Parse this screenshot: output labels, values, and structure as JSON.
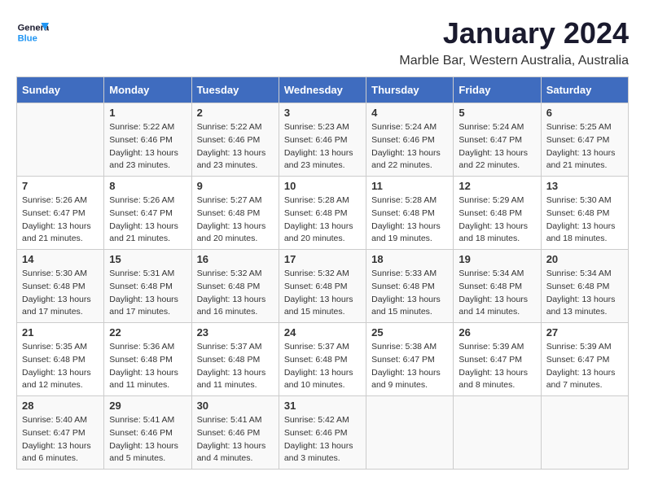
{
  "logo": {
    "line1": "General",
    "line2": "Blue"
  },
  "title": "January 2024",
  "subtitle": "Marble Bar, Western Australia, Australia",
  "days_header": [
    "Sunday",
    "Monday",
    "Tuesday",
    "Wednesday",
    "Thursday",
    "Friday",
    "Saturday"
  ],
  "weeks": [
    [
      {
        "num": "",
        "sunrise": "",
        "sunset": "",
        "daylight": ""
      },
      {
        "num": "1",
        "sunrise": "Sunrise: 5:22 AM",
        "sunset": "Sunset: 6:46 PM",
        "daylight": "Daylight: 13 hours and 23 minutes."
      },
      {
        "num": "2",
        "sunrise": "Sunrise: 5:22 AM",
        "sunset": "Sunset: 6:46 PM",
        "daylight": "Daylight: 13 hours and 23 minutes."
      },
      {
        "num": "3",
        "sunrise": "Sunrise: 5:23 AM",
        "sunset": "Sunset: 6:46 PM",
        "daylight": "Daylight: 13 hours and 23 minutes."
      },
      {
        "num": "4",
        "sunrise": "Sunrise: 5:24 AM",
        "sunset": "Sunset: 6:46 PM",
        "daylight": "Daylight: 13 hours and 22 minutes."
      },
      {
        "num": "5",
        "sunrise": "Sunrise: 5:24 AM",
        "sunset": "Sunset: 6:47 PM",
        "daylight": "Daylight: 13 hours and 22 minutes."
      },
      {
        "num": "6",
        "sunrise": "Sunrise: 5:25 AM",
        "sunset": "Sunset: 6:47 PM",
        "daylight": "Daylight: 13 hours and 21 minutes."
      }
    ],
    [
      {
        "num": "7",
        "sunrise": "Sunrise: 5:26 AM",
        "sunset": "Sunset: 6:47 PM",
        "daylight": "Daylight: 13 hours and 21 minutes."
      },
      {
        "num": "8",
        "sunrise": "Sunrise: 5:26 AM",
        "sunset": "Sunset: 6:47 PM",
        "daylight": "Daylight: 13 hours and 21 minutes."
      },
      {
        "num": "9",
        "sunrise": "Sunrise: 5:27 AM",
        "sunset": "Sunset: 6:48 PM",
        "daylight": "Daylight: 13 hours and 20 minutes."
      },
      {
        "num": "10",
        "sunrise": "Sunrise: 5:28 AM",
        "sunset": "Sunset: 6:48 PM",
        "daylight": "Daylight: 13 hours and 20 minutes."
      },
      {
        "num": "11",
        "sunrise": "Sunrise: 5:28 AM",
        "sunset": "Sunset: 6:48 PM",
        "daylight": "Daylight: 13 hours and 19 minutes."
      },
      {
        "num": "12",
        "sunrise": "Sunrise: 5:29 AM",
        "sunset": "Sunset: 6:48 PM",
        "daylight": "Daylight: 13 hours and 18 minutes."
      },
      {
        "num": "13",
        "sunrise": "Sunrise: 5:30 AM",
        "sunset": "Sunset: 6:48 PM",
        "daylight": "Daylight: 13 hours and 18 minutes."
      }
    ],
    [
      {
        "num": "14",
        "sunrise": "Sunrise: 5:30 AM",
        "sunset": "Sunset: 6:48 PM",
        "daylight": "Daylight: 13 hours and 17 minutes."
      },
      {
        "num": "15",
        "sunrise": "Sunrise: 5:31 AM",
        "sunset": "Sunset: 6:48 PM",
        "daylight": "Daylight: 13 hours and 17 minutes."
      },
      {
        "num": "16",
        "sunrise": "Sunrise: 5:32 AM",
        "sunset": "Sunset: 6:48 PM",
        "daylight": "Daylight: 13 hours and 16 minutes."
      },
      {
        "num": "17",
        "sunrise": "Sunrise: 5:32 AM",
        "sunset": "Sunset: 6:48 PM",
        "daylight": "Daylight: 13 hours and 15 minutes."
      },
      {
        "num": "18",
        "sunrise": "Sunrise: 5:33 AM",
        "sunset": "Sunset: 6:48 PM",
        "daylight": "Daylight: 13 hours and 15 minutes."
      },
      {
        "num": "19",
        "sunrise": "Sunrise: 5:34 AM",
        "sunset": "Sunset: 6:48 PM",
        "daylight": "Daylight: 13 hours and 14 minutes."
      },
      {
        "num": "20",
        "sunrise": "Sunrise: 5:34 AM",
        "sunset": "Sunset: 6:48 PM",
        "daylight": "Daylight: 13 hours and 13 minutes."
      }
    ],
    [
      {
        "num": "21",
        "sunrise": "Sunrise: 5:35 AM",
        "sunset": "Sunset: 6:48 PM",
        "daylight": "Daylight: 13 hours and 12 minutes."
      },
      {
        "num": "22",
        "sunrise": "Sunrise: 5:36 AM",
        "sunset": "Sunset: 6:48 PM",
        "daylight": "Daylight: 13 hours and 11 minutes."
      },
      {
        "num": "23",
        "sunrise": "Sunrise: 5:37 AM",
        "sunset": "Sunset: 6:48 PM",
        "daylight": "Daylight: 13 hours and 11 minutes."
      },
      {
        "num": "24",
        "sunrise": "Sunrise: 5:37 AM",
        "sunset": "Sunset: 6:48 PM",
        "daylight": "Daylight: 13 hours and 10 minutes."
      },
      {
        "num": "25",
        "sunrise": "Sunrise: 5:38 AM",
        "sunset": "Sunset: 6:47 PM",
        "daylight": "Daylight: 13 hours and 9 minutes."
      },
      {
        "num": "26",
        "sunrise": "Sunrise: 5:39 AM",
        "sunset": "Sunset: 6:47 PM",
        "daylight": "Daylight: 13 hours and 8 minutes."
      },
      {
        "num": "27",
        "sunrise": "Sunrise: 5:39 AM",
        "sunset": "Sunset: 6:47 PM",
        "daylight": "Daylight: 13 hours and 7 minutes."
      }
    ],
    [
      {
        "num": "28",
        "sunrise": "Sunrise: 5:40 AM",
        "sunset": "Sunset: 6:47 PM",
        "daylight": "Daylight: 13 hours and 6 minutes."
      },
      {
        "num": "29",
        "sunrise": "Sunrise: 5:41 AM",
        "sunset": "Sunset: 6:46 PM",
        "daylight": "Daylight: 13 hours and 5 minutes."
      },
      {
        "num": "30",
        "sunrise": "Sunrise: 5:41 AM",
        "sunset": "Sunset: 6:46 PM",
        "daylight": "Daylight: 13 hours and 4 minutes."
      },
      {
        "num": "31",
        "sunrise": "Sunrise: 5:42 AM",
        "sunset": "Sunset: 6:46 PM",
        "daylight": "Daylight: 13 hours and 3 minutes."
      },
      {
        "num": "",
        "sunrise": "",
        "sunset": "",
        "daylight": ""
      },
      {
        "num": "",
        "sunrise": "",
        "sunset": "",
        "daylight": ""
      },
      {
        "num": "",
        "sunrise": "",
        "sunset": "",
        "daylight": ""
      }
    ]
  ]
}
